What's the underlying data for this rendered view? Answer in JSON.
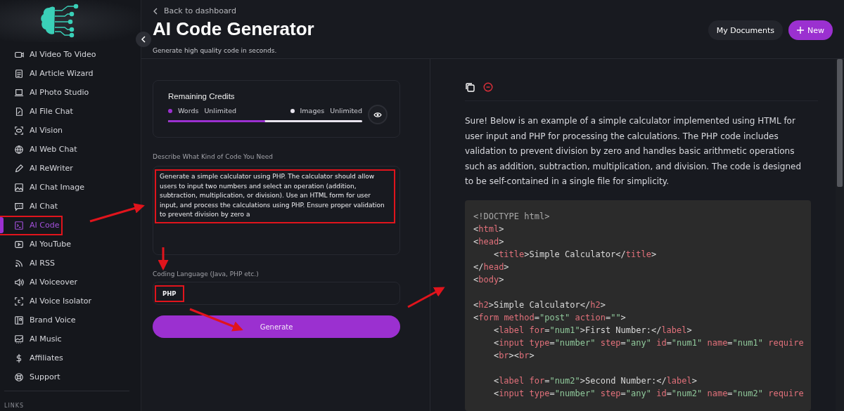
{
  "sidebar": {
    "items": [
      {
        "label": "AI Video To Video",
        "selected": false,
        "highlighted": false
      },
      {
        "label": "AI Article Wizard",
        "selected": false,
        "highlighted": false
      },
      {
        "label": "AI Photo Studio",
        "selected": false,
        "highlighted": false
      },
      {
        "label": "AI File Chat",
        "selected": false,
        "highlighted": false
      },
      {
        "label": "AI Vision",
        "selected": false,
        "highlighted": false
      },
      {
        "label": "AI Web Chat",
        "selected": false,
        "highlighted": false
      },
      {
        "label": "AI ReWriter",
        "selected": false,
        "highlighted": false
      },
      {
        "label": "AI Chat Image",
        "selected": false,
        "highlighted": false
      },
      {
        "label": "AI Chat",
        "selected": false,
        "highlighted": false
      },
      {
        "label": "AI Code",
        "selected": true,
        "highlighted": true
      },
      {
        "label": "AI YouTube",
        "selected": false,
        "highlighted": false
      },
      {
        "label": "AI RSS",
        "selected": false,
        "highlighted": false
      },
      {
        "label": "AI Voiceover",
        "selected": false,
        "highlighted": false
      },
      {
        "label": "AI Voice Isolator",
        "selected": false,
        "highlighted": false
      },
      {
        "label": "Brand Voice",
        "selected": false,
        "highlighted": false
      },
      {
        "label": "AI Music",
        "selected": false,
        "highlighted": false
      },
      {
        "label": "Affiliates",
        "selected": false,
        "highlighted": false
      },
      {
        "label": "Support",
        "selected": false,
        "highlighted": false
      }
    ],
    "section_label": "LINKS"
  },
  "header": {
    "back_link": "Back to dashboard",
    "title": "AI Code Generator",
    "subtitle": "Generate high quality code in seconds.",
    "buttons": [
      {
        "label": "My Documents",
        "kind": "secondary"
      },
      {
        "label": "New",
        "kind": "primary"
      }
    ]
  },
  "credits": {
    "title": "Remaining Credits",
    "items": [
      {
        "label": "Words",
        "value": "Unlimited",
        "color": "#9b30d0"
      },
      {
        "label": "Images",
        "value": "Unlimited",
        "color": "#e8e4ee"
      }
    ],
    "level": 0.5
  },
  "form": {
    "prompt": {
      "label": "Describe What Kind of Code You Need",
      "value": "Generate a simple calculator using PHP. The calculator should allow users to input two numbers and select an operation (addition, subtraction, multiplication, or division). Use an HTML form for user input, and process the calculations using PHP. Ensure proper validation to prevent division by zero a",
      "highlighted": true
    },
    "language": {
      "label": "Coding Language (Java, PHP etc.)",
      "value": "PHP",
      "highlighted": true
    },
    "submit": "Generate"
  },
  "result": {
    "intro": "Sure! Below is an example of a simple calculator implemented using HTML for user input and PHP for processing the calculations. The PHP code includes validation to prevent division by zero and handles basic arithmetic operations such as addition, subtraction, multiplication, and division. The code is designed to be self-contained in a single file for simplicity.",
    "code": [
      {
        "kind": "line",
        "text": "<!DOCTYPE html>"
      },
      {
        "kind": "line",
        "text": "<html>"
      },
      {
        "kind": "line",
        "text": "<head>"
      },
      {
        "kind": "line",
        "text": "    <title>Simple Calculator</title>"
      },
      {
        "kind": "line",
        "text": "</head>"
      },
      {
        "kind": "line",
        "text": "<body>"
      },
      {
        "kind": "blank"
      },
      {
        "kind": "line",
        "text": "<h2>Simple Calculator</h2>"
      },
      {
        "kind": "line",
        "text": "<form method=\"post\" action=\"\">"
      },
      {
        "kind": "line",
        "text": "    <label for=\"num1\">First Number:</label>"
      },
      {
        "kind": "line",
        "text": "    <input type=\"number\" step=\"any\" id=\"num1\" name=\"num1\" require"
      },
      {
        "kind": "line",
        "text": "    <br><br>"
      },
      {
        "kind": "blank"
      },
      {
        "kind": "line",
        "text": "    <label for=\"num2\">Second Number:</label>"
      },
      {
        "kind": "line",
        "text": "    <input type=\"number\" step=\"any\" id=\"num2\" name=\"num2\" require"
      }
    ]
  }
}
